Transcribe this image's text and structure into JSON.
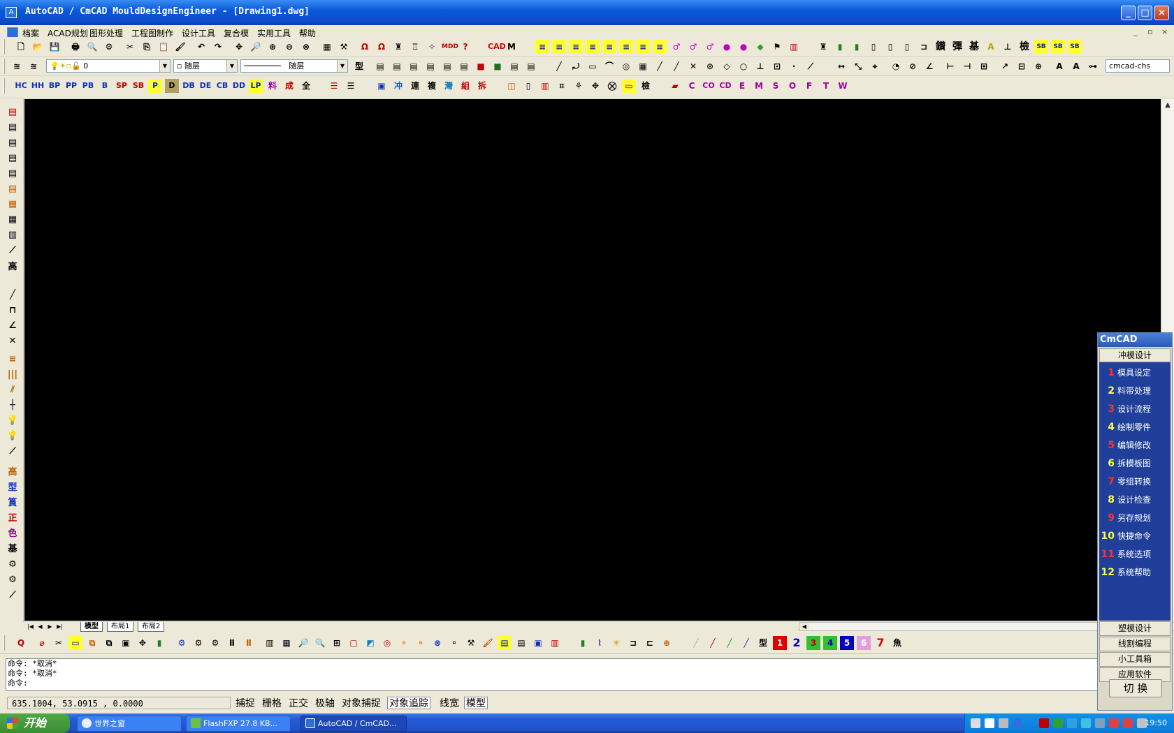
{
  "window": {
    "title": "AutoCAD / CmCAD MouldDesignEngineer - [Drawing1.dwg]",
    "min": "_",
    "max": "□",
    "close": "×"
  },
  "menu": {
    "items": [
      "档案",
      "ACAD规划",
      "图形处理",
      "工程图制作",
      "设计工具",
      "复合模",
      "实用工具",
      "帮助"
    ],
    "mdi": [
      "_",
      "▫",
      "×"
    ]
  },
  "toolbar2": {
    "layer": "0",
    "color": "随层",
    "linetype": "随层",
    "style_label": "cmcad-chs"
  },
  "toolbar3": {
    "buttons": [
      "HC",
      "HH",
      "BP",
      "PP",
      "PB",
      "B",
      "SP",
      "SB",
      "P",
      "D",
      "DB",
      "DE",
      "CB",
      "DD",
      "LP",
      "料",
      "成",
      "全"
    ],
    "mid": [
      "連",
      "複",
      "灣",
      "組",
      "拆"
    ],
    "letters": [
      "C",
      "CO",
      "CD",
      "E",
      "M",
      "S",
      "O",
      "F",
      "T",
      "W"
    ]
  },
  "left_toolbar": {
    "chars": [
      "高",
      "型",
      "篔",
      "正",
      "色",
      "基"
    ]
  },
  "layout_tabs": [
    "模型",
    "布局1",
    "布局2"
  ],
  "bottom_toolbar": {
    "numbers": [
      "1",
      "2",
      "3",
      "4",
      "5",
      "6",
      "7"
    ],
    "numbers_colors": [
      "#e00000",
      "#0000c0",
      "#00a000",
      "#00a000",
      "#0000c0",
      "#c030c0",
      "#e00000"
    ]
  },
  "command": {
    "lines": [
      "命令: *取消*",
      "命令: *取消*",
      "命令:"
    ]
  },
  "status": {
    "coords": "635.1004, 53.0915 , 0.0000",
    "toggles": [
      {
        "label": "捕捉",
        "on": false
      },
      {
        "label": "栅格",
        "on": false
      },
      {
        "label": "正交",
        "on": false
      },
      {
        "label": "极轴",
        "on": false
      },
      {
        "label": "对象捕捉",
        "on": false
      },
      {
        "label": "对象追踪",
        "on": true
      },
      {
        "label": "线宽",
        "on": false
      },
      {
        "label": "模型",
        "on": true
      }
    ]
  },
  "cmcad_panel": {
    "title": "CmCAD",
    "section": "冲模设计",
    "items": [
      {
        "num": "1",
        "label": "模具设定",
        "color": "#ff3030"
      },
      {
        "num": "2",
        "label": "料带处理",
        "color": "#ffff40"
      },
      {
        "num": "3",
        "label": "设计流程",
        "color": "#ff3030"
      },
      {
        "num": "4",
        "label": "绘制零件",
        "color": "#ffff40"
      },
      {
        "num": "5",
        "label": "编辑修改",
        "color": "#ff3030"
      },
      {
        "num": "6",
        "label": "拆模板图",
        "color": "#ffff40"
      },
      {
        "num": "7",
        "label": "零组转换",
        "color": "#ff3030"
      },
      {
        "num": "8",
        "label": "设计检查",
        "color": "#ffff40"
      },
      {
        "num": "9",
        "label": "另存规划",
        "color": "#ff3030"
      },
      {
        "num": "10",
        "label": "快捷命令",
        "color": "#ffff40"
      },
      {
        "num": "11",
        "label": "系统选项",
        "color": "#ff3030"
      },
      {
        "num": "12",
        "label": "系统帮助",
        "color": "#ffff40"
      }
    ],
    "buttons": [
      "塑模设计",
      "线割编程",
      "小工具箱",
      "应用软件"
    ],
    "switch": "切 换"
  },
  "taskbar": {
    "start": "开始",
    "items": [
      {
        "label": "世界之窗",
        "active": false
      },
      {
        "label": "FlashFXP 27.8 KB...",
        "active": false
      },
      {
        "label": "AutoCAD / CmCAD...",
        "active": true
      }
    ],
    "clock": "19:50"
  }
}
